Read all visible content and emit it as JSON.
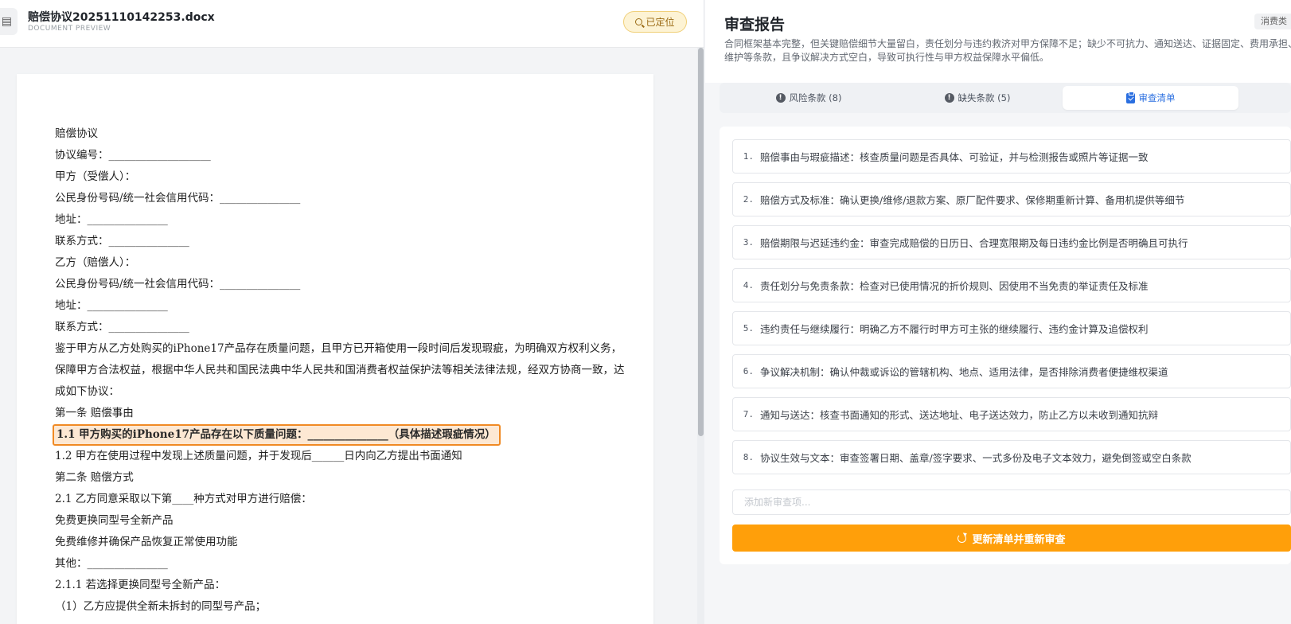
{
  "document": {
    "file_name": "赔偿协议20251110142253.docx",
    "subtitle": "DOCUMENT PREVIEW",
    "locate_badge": "已定位",
    "lines": [
      "赔偿协议",
      "协议编号：___________________",
      "甲方（受偿人）：",
      "公民身份号码/统一社会信用代码：_______________",
      "地址：_______________",
      "联系方式：_______________",
      "乙方（赔偿人）：",
      "公民身份号码/统一社会信用代码：_______________",
      "地址：_______________",
      "联系方式：_______________",
      "鉴于甲方从乙方处购买的iPhone17产品存在质量问题，且甲方已开箱使用一段时间后发现瑕疵，为明确双方权利义务，保障甲方合法权益，根据中华人民共和国民法典中华人民共和国消费者权益保护法等相关法律法规，经双方协商一致，达成如下协议：",
      "第一条 赔偿事由",
      "1.1 甲方购买的iPhone17产品存在以下质量问题：_______________（具体描述瑕疵情况）",
      "1.2 甲方在使用过程中发现上述质量问题，并于发现后______日内向乙方提出书面通知",
      "第二条 赔偿方式",
      "2.1 乙方同意采取以下第____种方式对甲方进行赔偿：",
      " 免费更换同型号全新产品",
      " 免费维修并确保产品恢复正常使用功能",
      " 其他：_______________",
      "2.1.1 若选择更换同型号全新产品：",
      "（1）乙方应提供全新未拆封的同型号产品；"
    ]
  },
  "report": {
    "title": "审查报告",
    "tag": "消费类",
    "summary": "合同框架基本完整，但关键赔偿细节大量留白，责任划分与违约救济对甲方保障不足；缺少不可抗力、通知送达、证据固定、费用承担、维护等条款，且争议解决方式空白，导致可执行性与甲方权益保障水平偏低。",
    "tabs": [
      {
        "label": "风险条款 (8)",
        "icon": "info-icon"
      },
      {
        "label": "缺失条款 (5)",
        "icon": "info-icon"
      },
      {
        "label": "审查清单",
        "icon": "clipboard-check-icon"
      }
    ],
    "checklist": [
      {
        "num": "1.",
        "text": "赔偿事由与瑕疵描述：核查质量问题是否具体、可验证，并与检测报告或照片等证据一致"
      },
      {
        "num": "2.",
        "text": "赔偿方式及标准：确认更换/维修/退款方案、原厂配件要求、保修期重新计算、备用机提供等细节"
      },
      {
        "num": "3.",
        "text": "赔偿期限与迟延违约金：审查完成赔偿的日历日、合理宽限期及每日违约金比例是否明确且可执行"
      },
      {
        "num": "4.",
        "text": "责任划分与免责条款：检查对已使用情况的折价规则、因使用不当免责的举证责任及标准"
      },
      {
        "num": "5.",
        "text": "违约责任与继续履行：明确乙方不履行时甲方可主张的继续履行、违约金计算及追偿权利"
      },
      {
        "num": "6.",
        "text": "争议解决机制：确认仲裁或诉讼的管辖机构、地点、适用法律，是否排除消费者便捷维权渠道"
      },
      {
        "num": "7.",
        "text": "通知与送达：核查书面通知的形式、送达地址、电子送达效力，防止乙方以未收到通知抗辩"
      },
      {
        "num": "8.",
        "text": "协议生效与文本：审查签署日期、盖章/签字要求、一式多份及电子文本效力，避免倒签或空白条款"
      }
    ],
    "add_placeholder": "添加新审查项...",
    "update_button": "更新清单并重新审查"
  }
}
